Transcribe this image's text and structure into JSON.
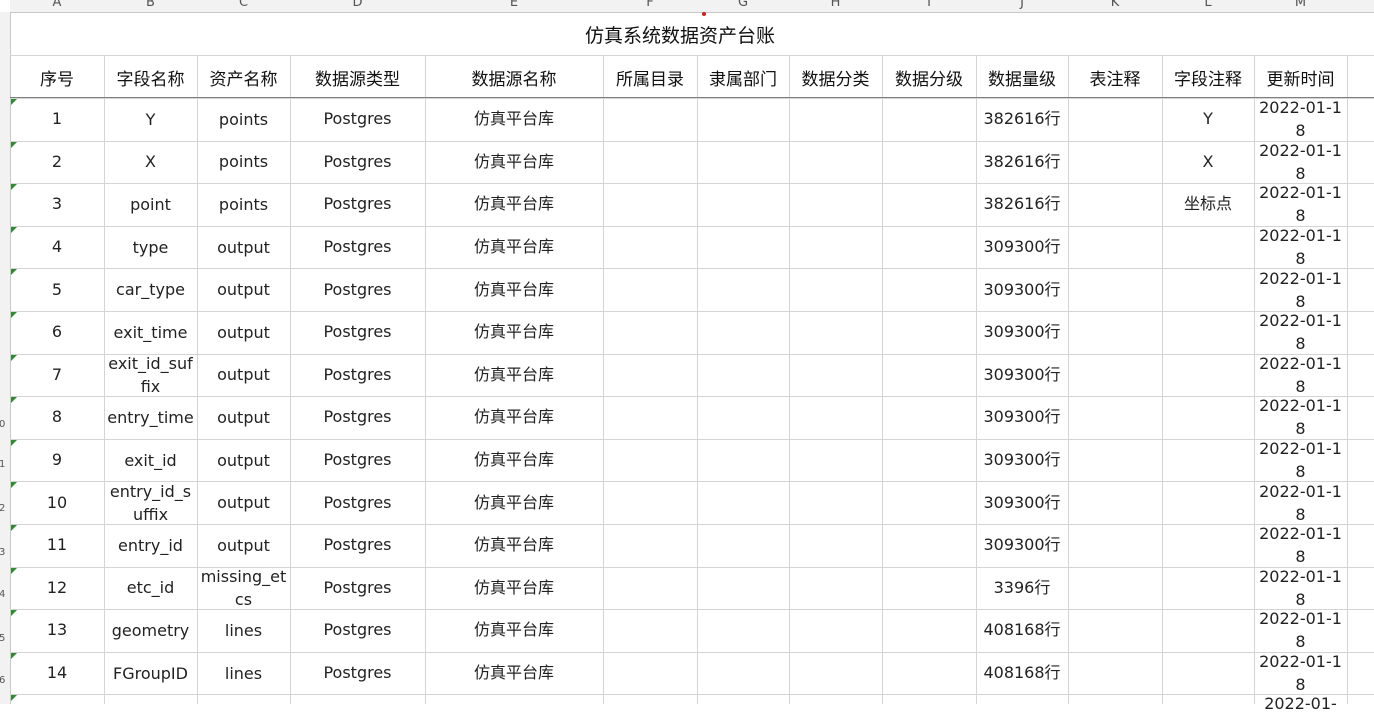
{
  "column_letters": [
    "A",
    "B",
    "C",
    "D",
    "E",
    "F",
    "G",
    "H",
    "I",
    "J",
    "K",
    "L",
    "M"
  ],
  "row_numbers": [
    "0",
    "1",
    "2",
    "3",
    "4",
    "5",
    "6"
  ],
  "title": "仿真系统数据资产台账",
  "headers": [
    "序号",
    "字段名称",
    "资产名称",
    "数据源类型",
    "数据源名称",
    "所属目录",
    "隶属部门",
    "数据分类",
    "数据分级",
    "数据量级",
    "表注释",
    "字段注释",
    "更新时间"
  ],
  "rows": [
    {
      "no": "1",
      "field": "Y",
      "asset": "points",
      "src_type": "Postgres",
      "src_name": "仿真平台库",
      "volume": "382616行",
      "field_note": "Y",
      "updated": "2022-01-18"
    },
    {
      "no": "2",
      "field": "X",
      "asset": "points",
      "src_type": "Postgres",
      "src_name": "仿真平台库",
      "volume": "382616行",
      "field_note": "X",
      "updated": "2022-01-18"
    },
    {
      "no": "3",
      "field": "point",
      "asset": "points",
      "src_type": "Postgres",
      "src_name": "仿真平台库",
      "volume": "382616行",
      "field_note": "坐标点",
      "updated": "2022-01-18"
    },
    {
      "no": "4",
      "field": "type",
      "asset": "output",
      "src_type": "Postgres",
      "src_name": "仿真平台库",
      "volume": "309300行",
      "field_note": "",
      "updated": "2022-01-18"
    },
    {
      "no": "5",
      "field": "car_type",
      "asset": "output",
      "src_type": "Postgres",
      "src_name": "仿真平台库",
      "volume": "309300行",
      "field_note": "",
      "updated": "2022-01-18"
    },
    {
      "no": "6",
      "field": "exit_time",
      "asset": "output",
      "src_type": "Postgres",
      "src_name": "仿真平台库",
      "volume": "309300行",
      "field_note": "",
      "updated": "2022-01-18"
    },
    {
      "no": "7",
      "field": "exit_id_suffix",
      "asset": "output",
      "src_type": "Postgres",
      "src_name": "仿真平台库",
      "volume": "309300行",
      "field_note": "",
      "updated": "2022-01-18"
    },
    {
      "no": "8",
      "field": "entry_time",
      "asset": "output",
      "src_type": "Postgres",
      "src_name": "仿真平台库",
      "volume": "309300行",
      "field_note": "",
      "updated": "2022-01-18"
    },
    {
      "no": "9",
      "field": "exit_id",
      "asset": "output",
      "src_type": "Postgres",
      "src_name": "仿真平台库",
      "volume": "309300行",
      "field_note": "",
      "updated": "2022-01-18"
    },
    {
      "no": "10",
      "field": "entry_id_suffix",
      "asset": "output",
      "src_type": "Postgres",
      "src_name": "仿真平台库",
      "volume": "309300行",
      "field_note": "",
      "updated": "2022-01-18"
    },
    {
      "no": "11",
      "field": "entry_id",
      "asset": "output",
      "src_type": "Postgres",
      "src_name": "仿真平台库",
      "volume": "309300行",
      "field_note": "",
      "updated": "2022-01-18"
    },
    {
      "no": "12",
      "field": "etc_id",
      "asset": "missing_etcs",
      "src_type": "Postgres",
      "src_name": "仿真平台库",
      "volume": "3396行",
      "field_note": "",
      "updated": "2022-01-18"
    },
    {
      "no": "13",
      "field": "geometry",
      "asset": "lines",
      "src_type": "Postgres",
      "src_name": "仿真平台库",
      "volume": "408168行",
      "field_note": "",
      "updated": "2022-01-18"
    },
    {
      "no": "14",
      "field": "FGroupID",
      "asset": "lines",
      "src_type": "Postgres",
      "src_name": "仿真平台库",
      "volume": "408168行",
      "field_note": "",
      "updated": "2022-01-18"
    }
  ],
  "partial_row": {
    "updated": "2022-01-"
  },
  "colors": {
    "comment_indicator": "#2e8b2e",
    "grid": "#d4d4d4",
    "header_bg": "#f2f2f2",
    "marker": "#d02020"
  }
}
